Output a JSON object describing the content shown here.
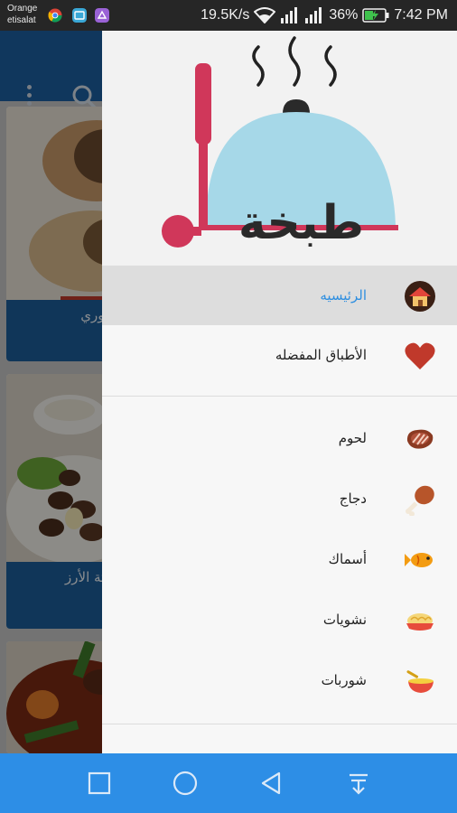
{
  "status_bar": {
    "carrier_line1": "Orange",
    "carrier_line2": "etisalat",
    "speed": "19.5K/s",
    "battery": "36%",
    "time": "7:42 PM"
  },
  "background": {
    "card1_caption": "ا السوري",
    "card2_caption_line1": "ل كفتة الأرز",
    "card2_caption_line2": "صرية"
  },
  "drawer": {
    "logo_text": "طبخة",
    "items": [
      {
        "label": "الرئيسيه",
        "icon": "home-icon",
        "active": true
      },
      {
        "label": "الأطباق المفضله",
        "icon": "heart-icon",
        "active": false
      },
      {
        "label": "لحوم",
        "icon": "steak-icon",
        "active": false
      },
      {
        "label": "دجاج",
        "icon": "chicken-leg-icon",
        "active": false
      },
      {
        "label": "أسماك",
        "icon": "fish-icon",
        "active": false
      },
      {
        "label": "نشويات",
        "icon": "pasta-icon",
        "active": false
      },
      {
        "label": "شوربات",
        "icon": "soup-bowl-icon",
        "active": false
      }
    ]
  },
  "nav_bar": {
    "buttons": [
      "recent-apps-icon",
      "home-circle-icon",
      "back-icon",
      "notifications-pull-icon"
    ]
  },
  "colors": {
    "toolbar": "#1d5fa0",
    "navbar": "#2d8ee6",
    "active_label": "#2f8fe0",
    "logo_dome": "#a6d8e8",
    "logo_accent": "#d0375a"
  }
}
